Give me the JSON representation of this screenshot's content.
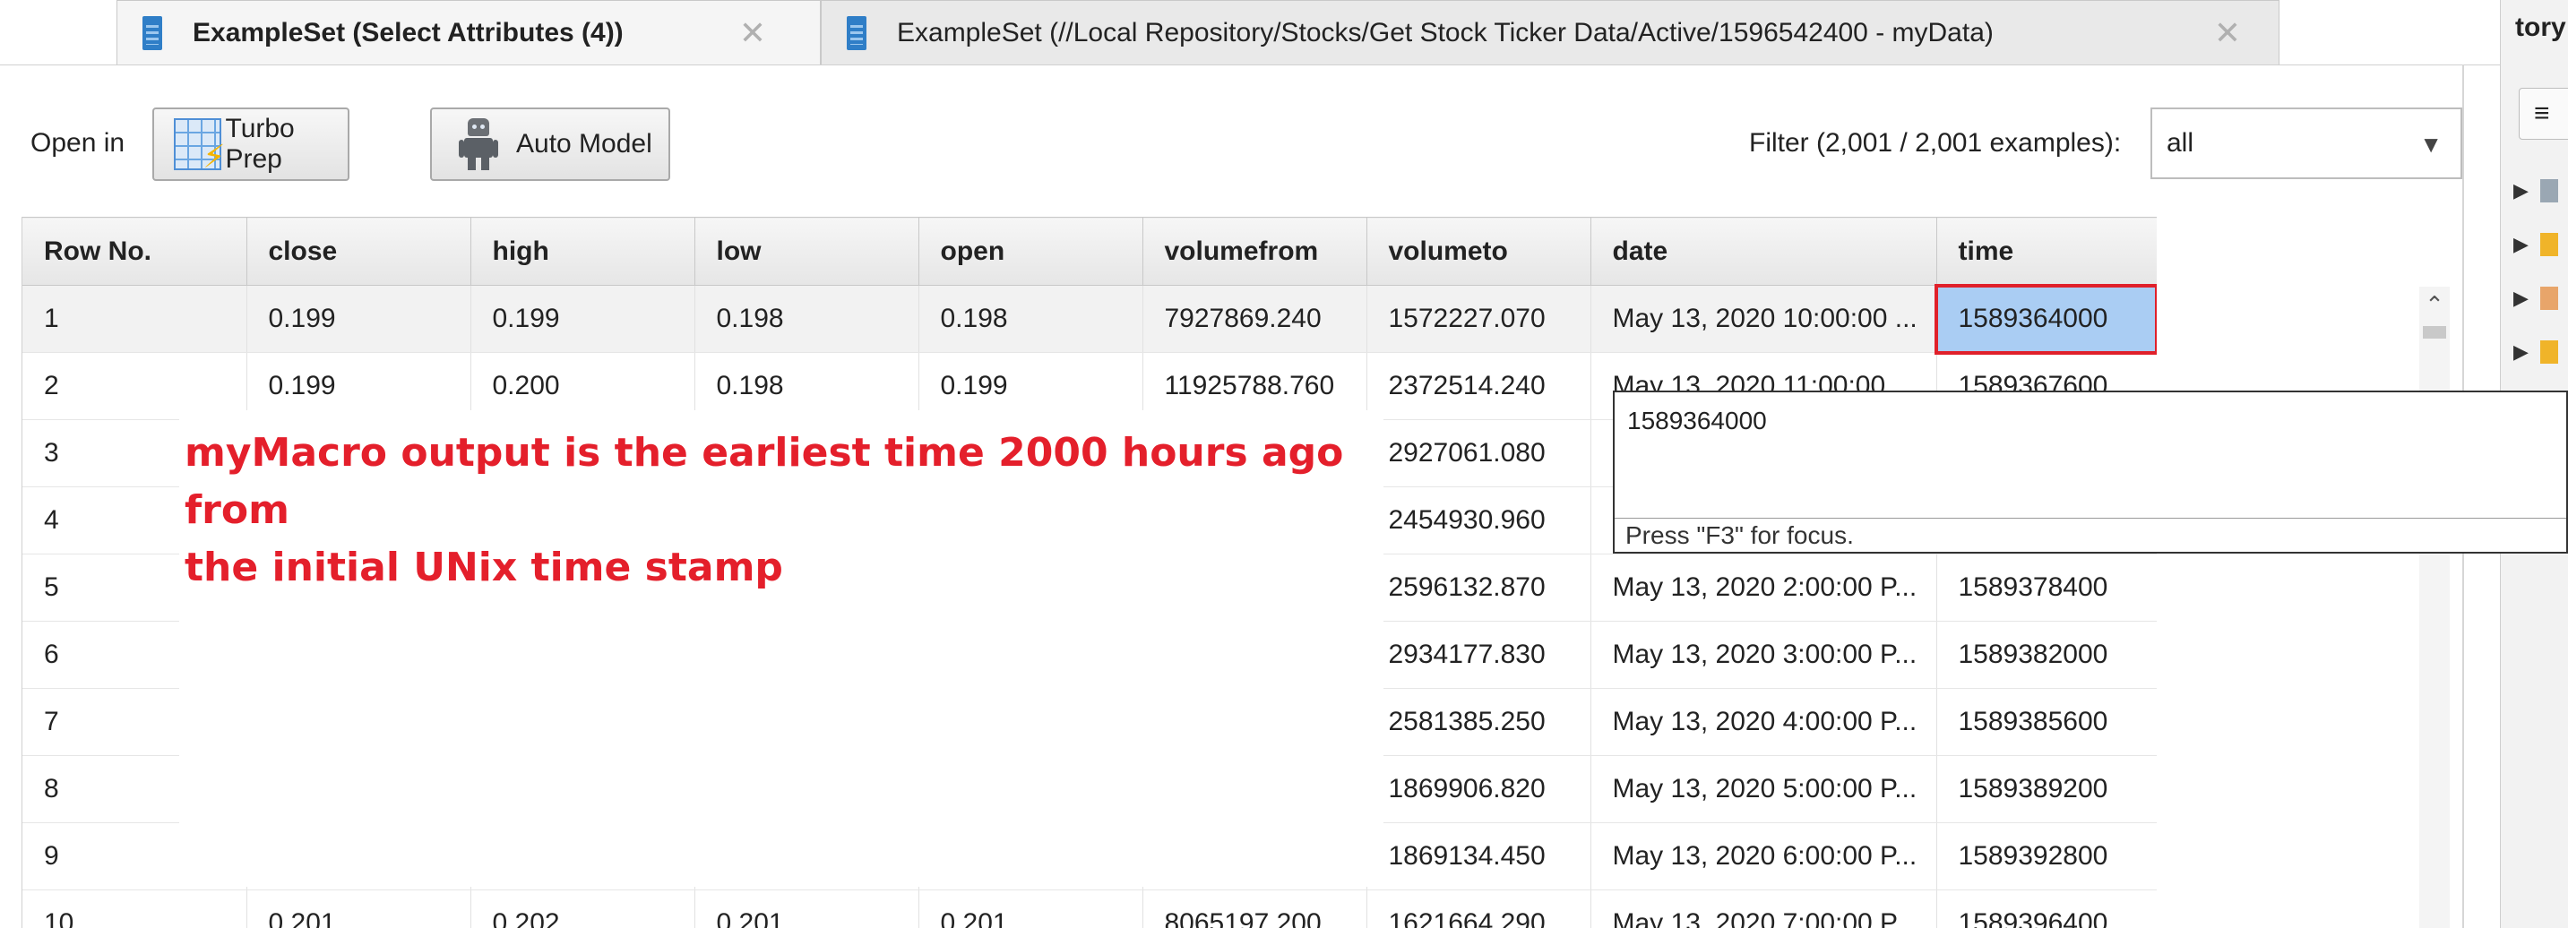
{
  "tabs": [
    {
      "label": "ExampleSet (Select Attributes (4))",
      "active": true
    },
    {
      "label": "ExampleSet (//Local Repository/Stocks/Get Stock Ticker Data/Active/1596542400 - myData)",
      "active": false
    }
  ],
  "right_panel": {
    "title": "tory",
    "menu_icon": "≡"
  },
  "toolbar": {
    "open_in_label": "Open in",
    "turbo_prep_label": "Turbo Prep",
    "auto_model_label": "Auto Model",
    "filter_label": "Filter (2,001 / 2,001 examples):",
    "filter_value": "all"
  },
  "table": {
    "columns": [
      "Row No.",
      "close",
      "high",
      "low",
      "open",
      "volumefrom",
      "volumeto",
      "date",
      "time"
    ],
    "rows": [
      [
        "1",
        "0.199",
        "0.199",
        "0.198",
        "0.198",
        "7927869.240",
        "1572227.070",
        "May 13, 2020 10:00:00 ...",
        "1589364000"
      ],
      [
        "2",
        "0.199",
        "0.200",
        "0.198",
        "0.199",
        "11925788.760",
        "2372514.240",
        "May 13, 2020 11:00:00 ...",
        "1589367600"
      ],
      [
        "3",
        "",
        "",
        "",
        "",
        "",
        "2927061.080",
        "",
        ""
      ],
      [
        "4",
        "",
        "",
        "",
        "",
        "",
        "2454930.960",
        "",
        ""
      ],
      [
        "5",
        "",
        "",
        "",
        "",
        "",
        "2596132.870",
        "May 13, 2020 2:00:00 P...",
        "1589378400"
      ],
      [
        "6",
        "",
        "",
        "",
        "",
        "",
        "2934177.830",
        "May 13, 2020 3:00:00 P...",
        "1589382000"
      ],
      [
        "7",
        "",
        "",
        "",
        "",
        "",
        "2581385.250",
        "May 13, 2020 4:00:00 P...",
        "1589385600"
      ],
      [
        "8",
        "",
        "",
        "",
        "",
        "",
        "1869906.820",
        "May 13, 2020 5:00:00 P...",
        "1589389200"
      ],
      [
        "9",
        "",
        "",
        "",
        "",
        "",
        "1869134.450",
        "May 13, 2020 6:00:00 P...",
        "1589392800"
      ],
      [
        "10",
        "0.201",
        "0.202",
        "0.201",
        "0.201",
        "8065197.200",
        "1621664.290",
        "May 13, 2020 7:00:00 P...",
        "1589396400"
      ]
    ]
  },
  "tooltip": {
    "value": "1589364000",
    "hint": "Press \"F3\" for focus."
  },
  "annotation": {
    "line1": "myMacro output is the earliest time 2000 hours ago from",
    "line2": "the initial UNix time stamp",
    "color": "#e41f2b"
  },
  "icons": [
    "document-icon",
    "close-icon",
    "turbo-prep-icon",
    "robot-icon",
    "dropdown-caret-icon",
    "scroll-up-icon"
  ]
}
